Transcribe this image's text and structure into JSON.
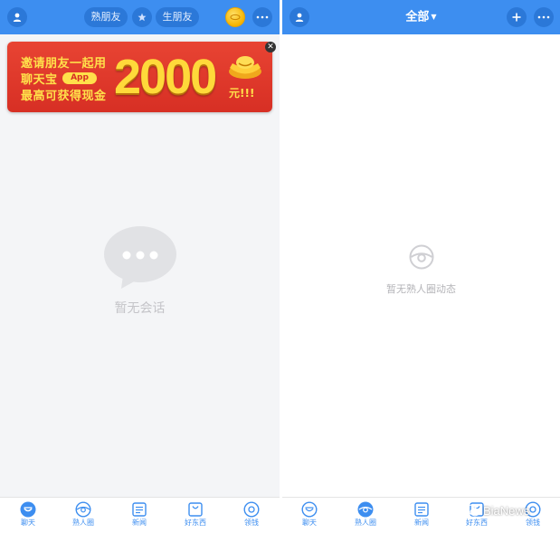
{
  "left_panel": {
    "header": {
      "filter_tabs": [
        "熟朋友",
        "生朋友"
      ],
      "star_icon": "star-icon",
      "profile_icon": "user-icon",
      "coin_icon": "coin-icon",
      "more_icon": "more-icon"
    },
    "banner": {
      "line1": "邀请朋友一起用",
      "line2": "聊天宝",
      "app_badge": "App",
      "line3": "最高可获得现金",
      "amount": "2000",
      "unit": "元!!!",
      "close_icon": "close-icon"
    },
    "empty_state": {
      "text": "暂无会话",
      "icon": "chat-bubble-icon"
    },
    "tabs": [
      {
        "label": "聊天",
        "icon": "chat-icon"
      },
      {
        "label": "熟人圈",
        "icon": "circle-icon"
      },
      {
        "label": "新闻",
        "icon": "news-icon"
      },
      {
        "label": "好东西",
        "icon": "shopping-bag-icon"
      },
      {
        "label": "领钱",
        "icon": "money-icon"
      }
    ]
  },
  "right_panel": {
    "header": {
      "title": "全部",
      "caret": "▼",
      "profile_icon": "user-icon",
      "add_icon": "plus-icon",
      "more_icon": "more-icon"
    },
    "empty_state": {
      "text": "暂无熟人圈动态",
      "icon": "ring-icon"
    },
    "tabs": [
      {
        "label": "聊天",
        "icon": "chat-icon"
      },
      {
        "label": "熟人圈",
        "icon": "circle-icon"
      },
      {
        "label": "新闻",
        "icon": "news-icon"
      },
      {
        "label": "好东西",
        "icon": "shopping-bag-icon"
      },
      {
        "label": "领钱",
        "icon": "money-icon"
      }
    ]
  },
  "watermark": {
    "text": "BiaNews"
  },
  "colors": {
    "accent": "#3d8ef0",
    "header_button": "#2b78d8",
    "banner_red": "#d72f24",
    "banner_gold": "#ffd93a",
    "empty_text": "#c4c4c8"
  }
}
